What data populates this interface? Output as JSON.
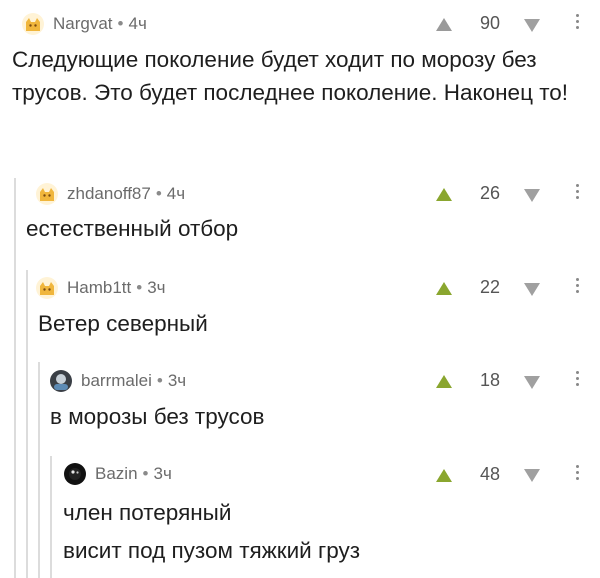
{
  "comments": [
    {
      "user": "Nargvat",
      "dot": "•",
      "time": "4ч",
      "score": "90",
      "text": "Следующие поколение будет ходит по морозу без трусов. Это будет последнее поколение. Наконец то!",
      "avatar_icon": "cat-avatar-icon",
      "vote_state": "neutral"
    },
    {
      "user": "zhdanoff87",
      "dot": "•",
      "time": "4ч",
      "score": "26",
      "text": "естественный отбор",
      "avatar_icon": "cat-avatar-icon",
      "vote_state": "upvoted"
    },
    {
      "user": "Hamb1tt",
      "dot": "•",
      "time": "3ч",
      "score": "22",
      "text": "Ветер северный",
      "avatar_icon": "cat-avatar-icon",
      "vote_state": "upvoted"
    },
    {
      "user": "barrmalei",
      "dot": "•",
      "time": "3ч",
      "score": "18",
      "text": "в морозы без трусов",
      "avatar_icon": "dark-avatar-icon",
      "vote_state": "upvoted"
    },
    {
      "user": "Bazin",
      "dot": "•",
      "time": "3ч",
      "score": "48",
      "text": "член потеряный\nвисит под пузом тяжкий груз",
      "avatar_icon": "black-avatar-icon",
      "vote_state": "upvoted"
    }
  ],
  "colors": {
    "upvote": "#8aa62f",
    "neutral_vote": "#9a9a9a",
    "thread_line": "#dcdcdc"
  }
}
